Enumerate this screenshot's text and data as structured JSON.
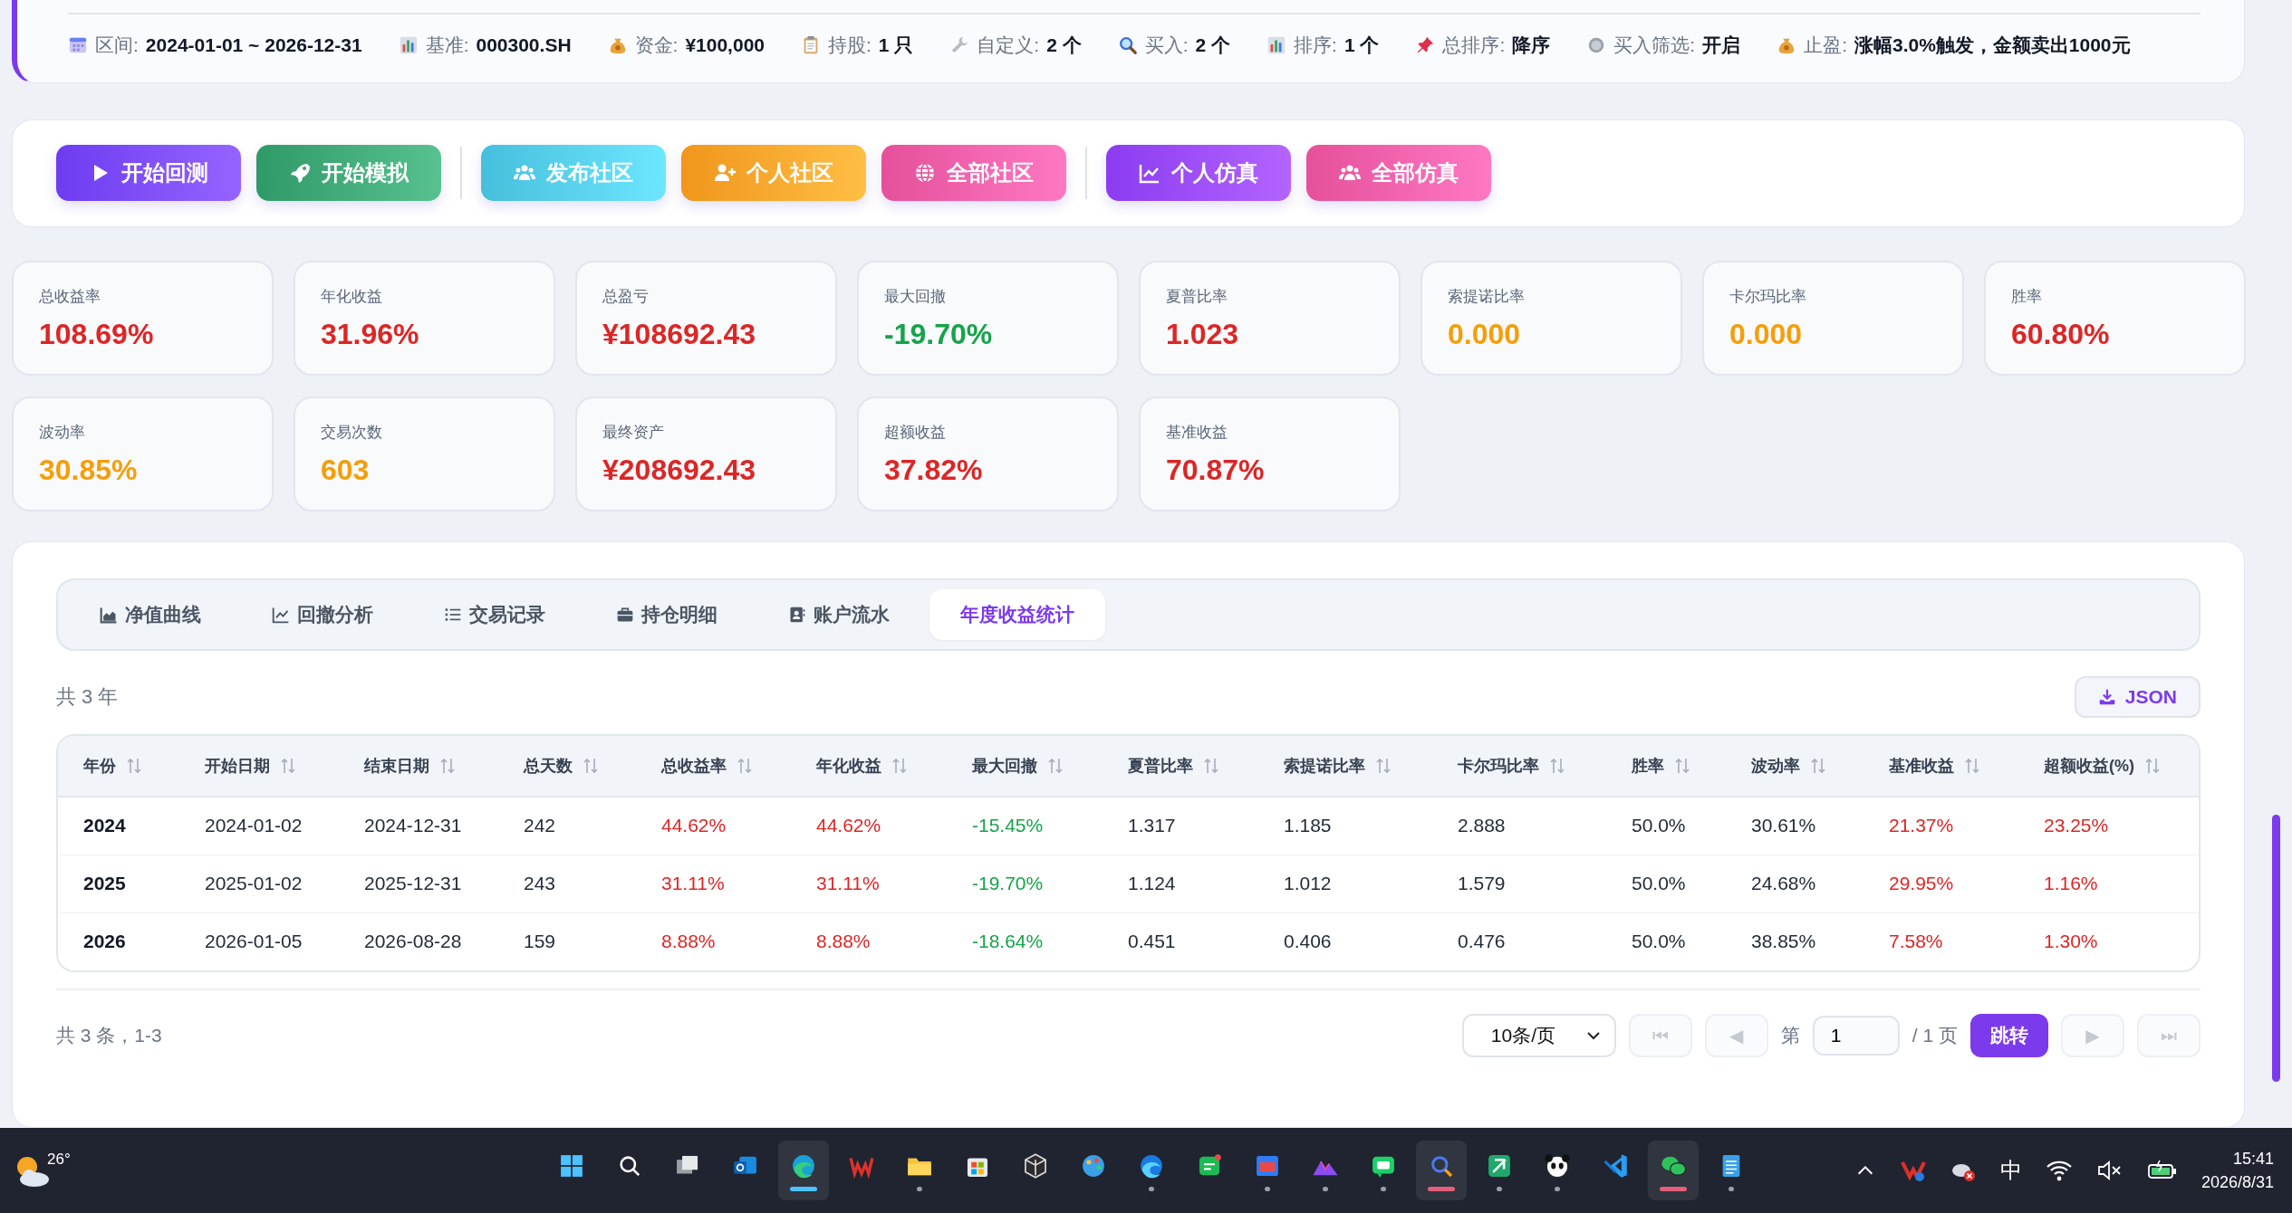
{
  "info_bar": {
    "items": [
      {
        "label": "区间:",
        "value": "2024-01-01 ~ 2026-12-31"
      },
      {
        "label": "基准:",
        "value": "000300.SH"
      },
      {
        "label": "资金:",
        "value": "¥100,000"
      },
      {
        "label": "持股:",
        "value": "1 只"
      },
      {
        "label": "自定义:",
        "value": "2 个"
      },
      {
        "label": "买入:",
        "value": "2 个"
      },
      {
        "label": "排序:",
        "value": "1 个"
      },
      {
        "label": "总排序:",
        "value": "降序"
      },
      {
        "label": "买入筛选:",
        "value": "开启"
      },
      {
        "label": "止盈:",
        "value": "涨幅3.0%触发，金额卖出1000元"
      }
    ]
  },
  "action_groups": [
    [
      {
        "label": "开始回测",
        "color": "#6d3cf0"
      },
      {
        "label": "开始模拟",
        "color": "#2f9a68"
      }
    ],
    [
      {
        "label": "发布社区",
        "color": "#45bfdc"
      },
      {
        "label": "个人社区",
        "color": "#f0961c"
      },
      {
        "label": "全部社区",
        "color": "#e5509a"
      }
    ],
    [
      {
        "label": "个人仿真",
        "color": "#8b3cf0"
      },
      {
        "label": "全部仿真",
        "color": "#e5509a"
      }
    ]
  ],
  "metrics": [
    {
      "label": "总收益率",
      "value": "108.69%",
      "color": "#dc2626"
    },
    {
      "label": "年化收益",
      "value": "31.96%",
      "color": "#dc2626"
    },
    {
      "label": "总盈亏",
      "value": "¥108692.43",
      "color": "#dc2626"
    },
    {
      "label": "最大回撤",
      "value": "-19.70%",
      "color": "#16a34a"
    },
    {
      "label": "夏普比率",
      "value": "1.023",
      "color": "#dc2626"
    },
    {
      "label": "索提诺比率",
      "value": "0.000",
      "color": "#f59e0b"
    },
    {
      "label": "卡尔玛比率",
      "value": "0.000",
      "color": "#f59e0b"
    },
    {
      "label": "胜率",
      "value": "60.80%",
      "color": "#dc2626"
    },
    {
      "label": "波动率",
      "value": "30.85%",
      "color": "#f59e0b"
    },
    {
      "label": "交易次数",
      "value": "603",
      "color": "#f59e0b"
    },
    {
      "label": "最终资产",
      "value": "¥208692.43",
      "color": "#dc2626"
    },
    {
      "label": "超额收益",
      "value": "37.82%",
      "color": "#dc2626"
    },
    {
      "label": "基准收益",
      "value": "70.87%",
      "color": "#dc2626"
    }
  ],
  "tabs": [
    {
      "label": "净值曲线",
      "selected": false
    },
    {
      "label": "回撤分析",
      "selected": false
    },
    {
      "label": "交易记录",
      "selected": false
    },
    {
      "label": "持仓明细",
      "selected": false
    },
    {
      "label": "账户流水",
      "selected": false
    },
    {
      "label": "年度收益统计",
      "selected": true
    }
  ],
  "summary": "共 3 年",
  "export_button": "JSON",
  "table": {
    "columns": [
      {
        "label": "年份"
      },
      {
        "label": "开始日期"
      },
      {
        "label": "结束日期"
      },
      {
        "label": "总天数"
      },
      {
        "label": "总收益率",
        "color": "#dc2626"
      },
      {
        "label": "年化收益",
        "color": "#dc2626"
      },
      {
        "label": "最大回撤",
        "color": "#16a34a"
      },
      {
        "label": "夏普比率"
      },
      {
        "label": "索提诺比率"
      },
      {
        "label": "卡尔玛比率"
      },
      {
        "label": "胜率"
      },
      {
        "label": "波动率"
      },
      {
        "label": "基准收益",
        "color": "#dc2626"
      },
      {
        "label": "超额收益(%)",
        "color": "#dc2626"
      }
    ],
    "rows": [
      [
        "2024",
        "2024-01-02",
        "2024-12-31",
        "242",
        "44.62%",
        "44.62%",
        "-15.45%",
        "1.317",
        "1.185",
        "2.888",
        "50.0%",
        "30.61%",
        "21.37%",
        "23.25%"
      ],
      [
        "2025",
        "2025-01-02",
        "2025-12-31",
        "243",
        "31.11%",
        "31.11%",
        "-19.70%",
        "1.124",
        "1.012",
        "1.579",
        "50.0%",
        "24.68%",
        "29.95%",
        "1.16%"
      ],
      [
        "2026",
        "2026-01-05",
        "2026-08-28",
        "159",
        "8.88%",
        "8.88%",
        "-18.64%",
        "0.451",
        "0.406",
        "0.476",
        "50.0%",
        "38.85%",
        "7.58%",
        "1.30%"
      ]
    ]
  },
  "pagination": {
    "info": "共 3 条，1-3",
    "page_size": "10条/页",
    "first": {
      "glyph": "⏮",
      "disabled": true
    },
    "prev": {
      "glyph": "◀",
      "disabled": true
    },
    "page_prefix": "第",
    "page": "1",
    "page_suffix": "/ 1 页",
    "jump": "跳转",
    "next": {
      "glyph": "▶",
      "disabled": true
    },
    "last": {
      "glyph": "⏭",
      "disabled": true
    }
  },
  "taskbar": {
    "weather": "26°",
    "apps": [
      {
        "running": false,
        "active": false
      },
      {
        "running": false,
        "active": false
      },
      {
        "running": false,
        "active": false
      },
      {
        "running": false,
        "active": false
      },
      {
        "running": true,
        "active": true
      },
      {
        "running": false,
        "active": false
      },
      {
        "running": true,
        "active": false
      },
      {
        "running": false,
        "active": false
      },
      {
        "running": false,
        "active": false
      },
      {
        "running": false,
        "active": false
      },
      {
        "running": true,
        "active": false
      },
      {
        "running": false,
        "active": false
      },
      {
        "running": true,
        "active": false
      },
      {
        "running": true,
        "active": false
      },
      {
        "running": true,
        "active": false
      },
      {
        "running": true,
        "active": true
      },
      {
        "running": true,
        "active": false
      },
      {
        "running": true,
        "active": false
      },
      {
        "running": false,
        "active": false
      },
      {
        "running": true,
        "active": true
      },
      {
        "running": true,
        "active": false
      }
    ],
    "ime": "中",
    "time": "15:41",
    "date": "2026/8/31"
  }
}
